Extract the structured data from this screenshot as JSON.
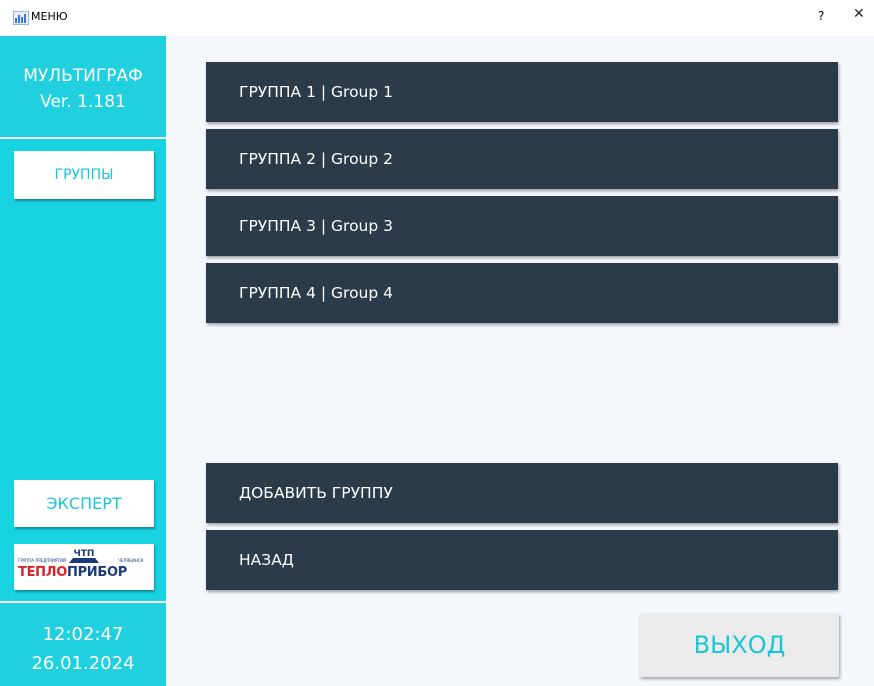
{
  "window": {
    "title": "МЕНЮ",
    "help_label": "?",
    "close_label": "✕"
  },
  "sidebar": {
    "app_name": "МУЛЬТИГРАФ",
    "app_version": "Ver. 1.181",
    "groups_tab_label": "ГРУППЫ",
    "expert_label": "ЭКСПЕРТ",
    "logo": {
      "text_red": "ТЕПЛО",
      "text_blue": "ПРИБОР",
      "caption_left": "ГРУППА ПРЕДПРИЯТИЙ",
      "caption_right": "ЧЕЛЯБИНСК",
      "emblem": "ЧТП"
    },
    "clock_time": "12:02:47",
    "clock_date": "26.01.2024"
  },
  "main": {
    "groups": [
      {
        "label": "ГРУППА 1 | Group 1"
      },
      {
        "label": "ГРУППА 2 | Group 2"
      },
      {
        "label": "ГРУППА 3 | Group 3"
      },
      {
        "label": "ГРУППА 4 | Group 4"
      }
    ],
    "add_group_label": "ДОБАВИТЬ ГРУППУ",
    "back_label": "НАЗАД",
    "exit_label": "ВЫХОД"
  },
  "colors": {
    "sidebar_cyan": "#18d3e2",
    "button_dark": "#2c3b4a",
    "accent_text": "#18c6d6",
    "main_bg": "#f4f8fc"
  }
}
